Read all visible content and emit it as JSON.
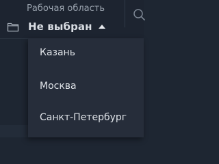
{
  "workspace": {
    "label": "Рабочая область",
    "value": "Не выбран"
  },
  "icons": {
    "folder": "folder-icon",
    "caret": "caret-up-icon",
    "search": "search-icon"
  },
  "dropdown": {
    "items": [
      {
        "label": "Казань"
      },
      {
        "label": "Москва"
      },
      {
        "label": "Санкт-Петербург"
      }
    ]
  },
  "colors": {
    "background": "#1e2632",
    "topbar": "#1d2430",
    "dropdown": "#262d3a",
    "text": "#dfe3e8",
    "muted": "#9aa3ae"
  }
}
